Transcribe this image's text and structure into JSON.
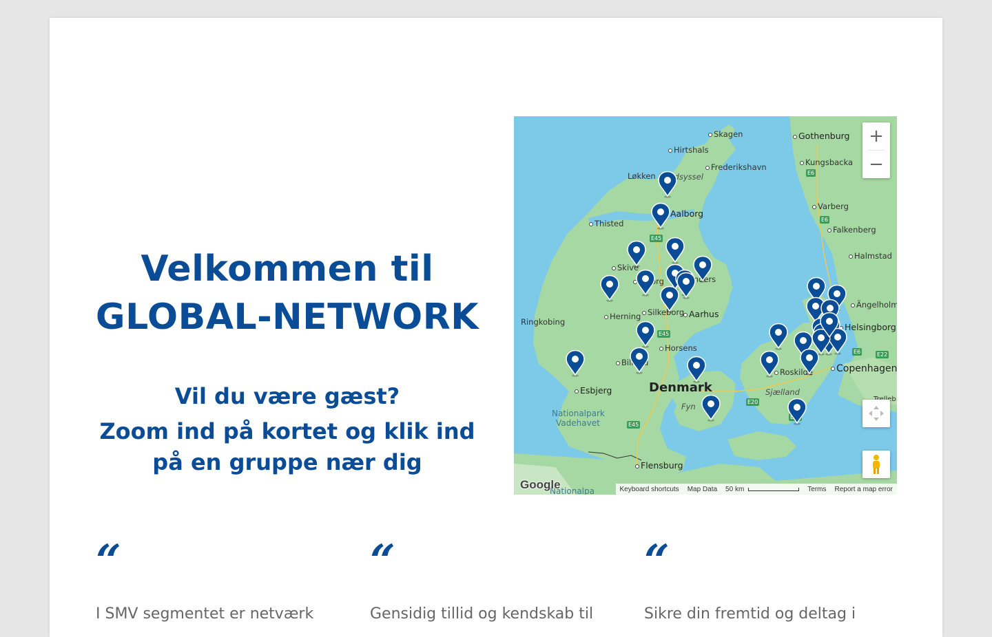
{
  "hero": {
    "title_line1": "Velkommen til",
    "title_line2": "GLOBAL-NETWORK",
    "sub_line1": "Vil du være gæst?",
    "sub_line2": "Zoom ind på kortet og klik ind",
    "sub_line3": "på en gruppe nær dig"
  },
  "map": {
    "places": {
      "skagen": "Skagen",
      "hirtshals": "Hirtshals",
      "frederikshavn": "Frederikshavn",
      "lokken": "Løkken",
      "vendsyssel": "Vendsyssel",
      "aalborg": "Aalborg",
      "thisted": "Thisted",
      "skive": "Skive",
      "viborg": "Viborg",
      "randers": "Randers",
      "herning": "Herning",
      "silkeborg": "Silkeborg",
      "aarhus": "Aarhus",
      "ringkobing": "Ringkobing",
      "horsens": "Horsens",
      "billund": "Billund",
      "esbjerg": "Esbjerg",
      "denmark": "Denmark",
      "fyn": "Fyn",
      "nationalpark": "Nationalpark",
      "vadehavet": "Vadehavet",
      "flensburg": "Flensburg",
      "nationalpa": "Nationalpa",
      "gothenburg": "Gothenburg",
      "kungsbacka": "Kungsbacka",
      "varberg": "Varberg",
      "falkenberg": "Falkenberg",
      "halmstad": "Halmstad",
      "angelholm": "Ängelholm",
      "helsingborg": "Helsingborg",
      "roskilde": "Roskilde",
      "sjaelland": "Sjælland",
      "copenhagen": "Copenhagen",
      "trelleborg": "Trelleb"
    },
    "roads": {
      "e45a": "E45",
      "e45b": "E45",
      "e45c": "E45",
      "e6a": "E6",
      "e6b": "E6",
      "e6c": "E6",
      "e20": "E20",
      "e47": "E47",
      "e22": "E22"
    },
    "controls": {
      "zoom_in": "+",
      "zoom_out": "−"
    },
    "logo": "Google",
    "attribution": {
      "shortcuts": "Keyboard shortcuts",
      "map_data": "Map Data",
      "scale": "50 km",
      "terms": "Terms",
      "report": "Report a map error"
    },
    "marker_color": "#0a4c96",
    "marker_count": 32
  },
  "quotes": [
    {
      "mark": "“",
      "text": "I SMV segmentet er netværk"
    },
    {
      "mark": "“",
      "text": "Gensidig tillid og kendskab til"
    },
    {
      "mark": "“",
      "text": "Sikre din fremtid og deltag i"
    }
  ]
}
